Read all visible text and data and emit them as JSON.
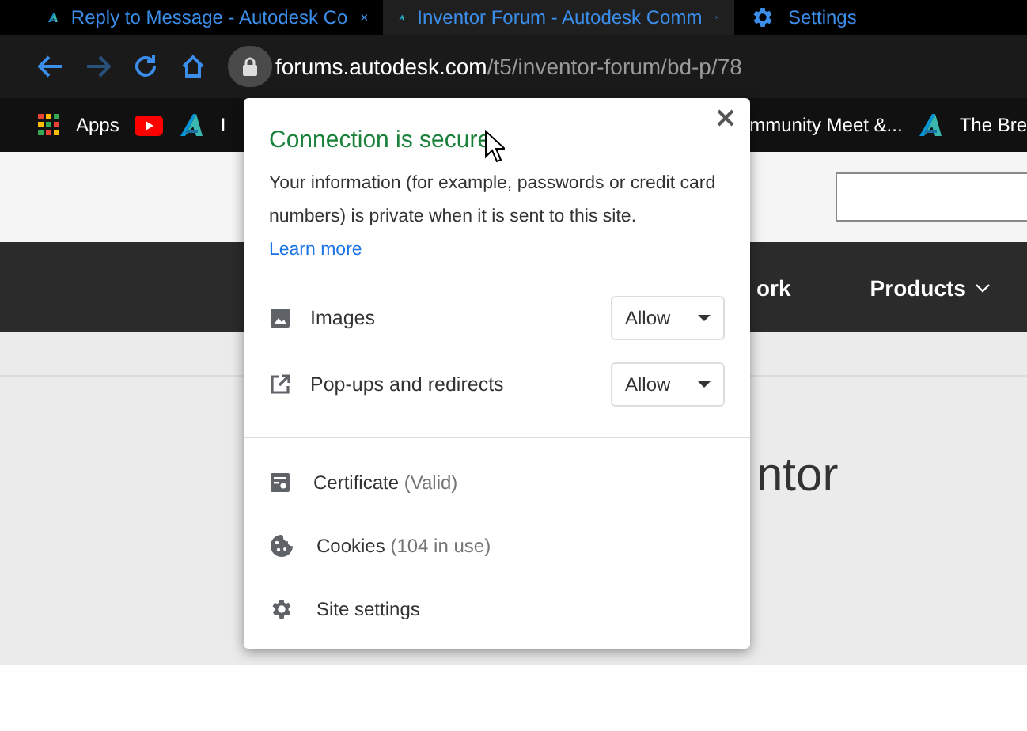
{
  "tabs": [
    {
      "title": "Reply to Message - Autodesk Co",
      "closable": true,
      "selected": false
    },
    {
      "title": "Inventor Forum - Autodesk Comm",
      "closable": true,
      "selected": true
    },
    {
      "title": "Settings",
      "closable": false,
      "selected": false
    }
  ],
  "toolbar": {
    "url_host": "forums.autodesk.com",
    "url_path": "/t5/inventor-forum/bd-p/78"
  },
  "bookmarks": {
    "left": [
      {
        "label": "Apps"
      },
      {
        "label": "I"
      }
    ],
    "right": [
      {
        "label": "mmunity Meet &..."
      },
      {
        "label": "The Bre"
      }
    ]
  },
  "page": {
    "nav_items": [
      {
        "label": "ork",
        "has_caret": false
      },
      {
        "label": "Products",
        "has_caret": true
      }
    ],
    "heading": "ntor"
  },
  "popup": {
    "title": "Connection is secure",
    "description": "Your information (for example, passwords or credit card numbers) is private when it is sent to this site.",
    "link": "Learn more",
    "permissions": [
      {
        "label": "Images",
        "value": "Allow"
      },
      {
        "label": "Pop-ups and redirects",
        "value": "Allow"
      }
    ],
    "items": [
      {
        "label": "Certificate",
        "detail": "(Valid)"
      },
      {
        "label": "Cookies",
        "detail": "(104 in use)"
      },
      {
        "label": "Site settings"
      }
    ]
  }
}
